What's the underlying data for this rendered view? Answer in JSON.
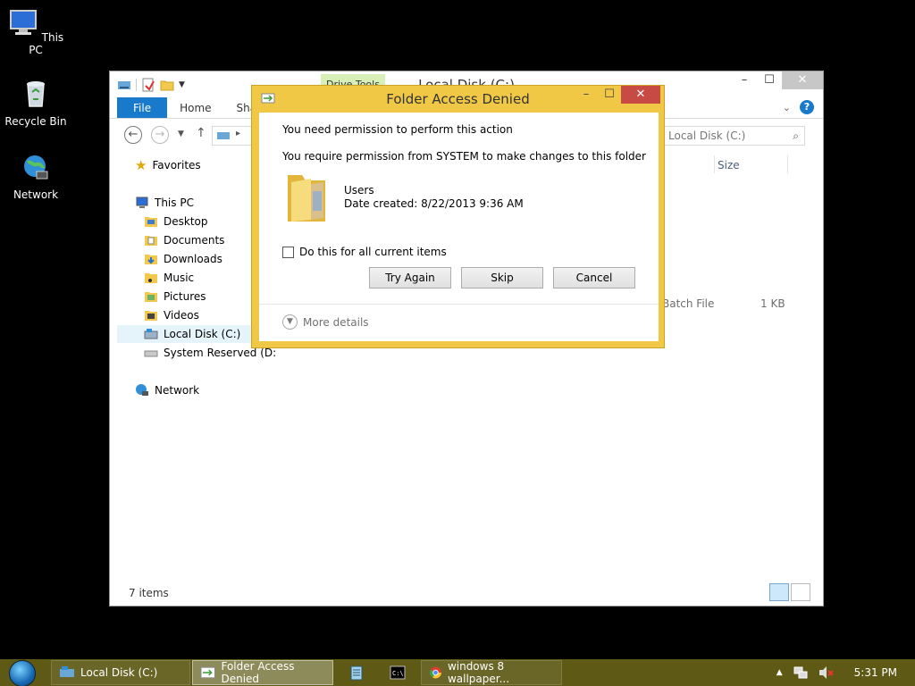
{
  "desktop": {
    "icons": [
      {
        "label": "This PC"
      },
      {
        "label": "Recycle Bin"
      },
      {
        "label": "Network"
      }
    ]
  },
  "explorer": {
    "title": "Local Disk (C:)",
    "contextual_tab": "Drive Tools",
    "ribbon_tabs": [
      "File",
      "Home",
      "Shar"
    ],
    "search_placeholder": "Local Disk (C:)",
    "column_size": "Size",
    "nav": {
      "favorites": "Favorites",
      "this_pc": "This PC",
      "desktop": "Desktop",
      "documents": "Documents",
      "downloads": "Downloads",
      "music": "Music",
      "pictures": "Pictures",
      "videos": "Videos",
      "local_disk": "Local Disk (C:)",
      "system_reserved": "System Reserved (D:",
      "network": "Network"
    },
    "file_row": {
      "type": "Batch File",
      "size": "1 KB"
    },
    "status": "7 items"
  },
  "dialog": {
    "title": "Folder Access Denied",
    "message1": "You need permission to perform this action",
    "message2": "You require permission from SYSTEM to make changes to this folder",
    "item_name": "Users",
    "item_date": "Date created: 8/22/2013 9:36 AM",
    "checkbox_label": "Do this for all current items",
    "checkbox_checked": false,
    "buttons": {
      "try_again": "Try Again",
      "skip": "Skip",
      "cancel": "Cancel"
    },
    "more_details": "More details",
    "accent_color": "#f0c846"
  },
  "taskbar": {
    "items": [
      {
        "label": "Local Disk (C:)"
      },
      {
        "label": "Folder Access Denied"
      },
      {
        "label": "windows 8 wallpaper..."
      }
    ],
    "clock": "5:31 PM"
  }
}
